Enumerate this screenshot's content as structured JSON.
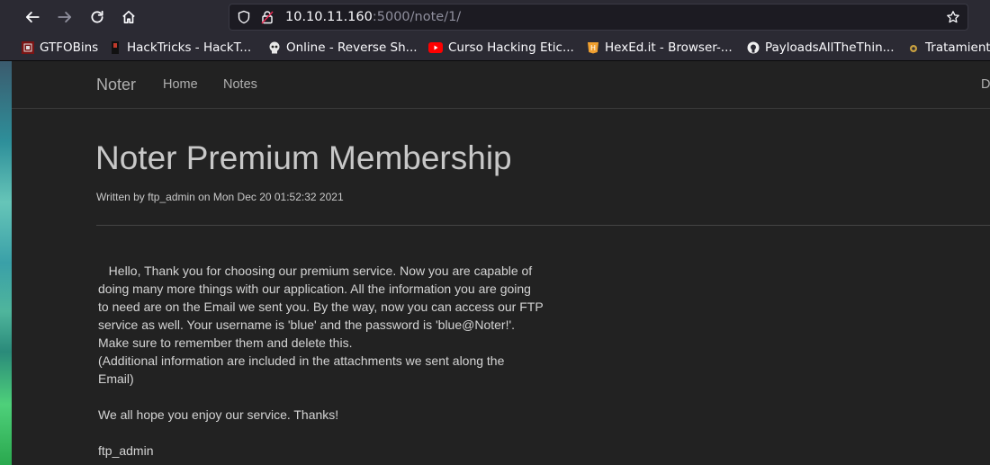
{
  "browser": {
    "url_host": "10.10.11.160",
    "url_path": ":5000/note/1/",
    "bookmarks": [
      {
        "label": "GTFOBins",
        "icon": "gtfobins-icon"
      },
      {
        "label": "HackTricks - HackT...",
        "icon": "hacktricks-icon"
      },
      {
        "label": "Online - Reverse Sh...",
        "icon": "skull-icon"
      },
      {
        "label": "Curso Hacking Etic...",
        "icon": "youtube-icon"
      },
      {
        "label": "HexEd.it - Browser-...",
        "icon": "hexed-icon"
      },
      {
        "label": "PayloadsAllTheThin...",
        "icon": "github-icon"
      },
      {
        "label": "Tratamient",
        "icon": "tratamiento-icon"
      }
    ]
  },
  "navbar": {
    "brand": "Noter",
    "links": [
      "Home",
      "Notes"
    ],
    "right_fragment": "D"
  },
  "note": {
    "title": "Noter Premium Membership",
    "byline": "Written by ftp_admin on Mon Dec 20 01:52:32 2021",
    "body_lines": [
      "   Hello, Thank you for choosing our premium service. Now you are capable of",
      "doing many more things with our application. All the information you are going",
      "to need are on the Email we sent you. By the way, now you can access our FTP",
      "service as well. Your username is 'blue' and the password is 'blue@Noter!'.",
      "Make sure to remember them and delete this.",
      "(Additional information are included in the attachments we sent along the",
      "Email)",
      "",
      "We all hope you enjoy our service. Thanks!",
      "",
      "ftp_admin"
    ]
  },
  "colors": {
    "chrome_bg": "#2b2a33",
    "page_bg": "#222222",
    "text": "#c8c8c8"
  }
}
